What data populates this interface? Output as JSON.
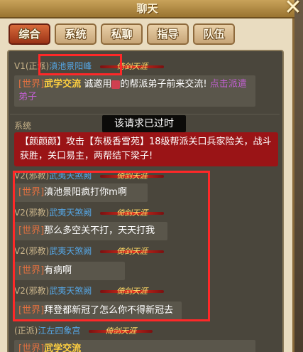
{
  "header": {
    "title": "聊天",
    "close_icon": "close-icon"
  },
  "tabs": [
    {
      "label": "综合",
      "active": true
    },
    {
      "label": "系统",
      "active": false
    },
    {
      "label": "私聊",
      "active": false
    },
    {
      "label": "指导",
      "active": false
    },
    {
      "label": "队伍",
      "active": false
    }
  ],
  "ornament_text": "倚剑天涯",
  "messages": {
    "m1": {
      "level": "V1",
      "faction": "(正派)",
      "name": "滇池景阳峰",
      "channel": "[世界]",
      "highlight": "武学交流",
      "text": "诚邀用",
      "text2": "的帮派弟子前来交流!",
      "link": "点击派遣弟子"
    },
    "sys": {
      "label": "系统",
      "text": "【颜颜颜】攻击【东极香雪苑】18级帮派关口兵家险关，战斗获胜，关口易主，两帮结下梁子!"
    },
    "tooltip": "该请求已过时",
    "m2": {
      "level": "V2",
      "faction": "(邪教)",
      "name": "武夷天煞阙",
      "channel": "[世界]",
      "text": "滇池景阳疯打你m啊"
    },
    "m3": {
      "level": "V2",
      "faction": "(邪教)",
      "name": "武夷天煞阙",
      "channel": "[世界]",
      "text": "那么多空关不打，天天打我"
    },
    "m4": {
      "level": "V2",
      "faction": "(邪教)",
      "name": "武夷天煞阙",
      "channel": "[世界]",
      "text": "有病啊"
    },
    "m5": {
      "level": "V2",
      "faction": "(邪教)",
      "name": "武夷天煞阙",
      "channel": "[世界]",
      "text": "拜登都新冠了怎么你不得新冠去"
    },
    "m6": {
      "faction": "(正派)",
      "name": "江左四象宫",
      "channel": "[世界]",
      "highlight": "武学交流"
    }
  },
  "colors": {
    "accent": "#9a3216",
    "name_blue": "#55a8e8",
    "system_red": "#9a1416",
    "annotation_red": "#ff2828"
  }
}
